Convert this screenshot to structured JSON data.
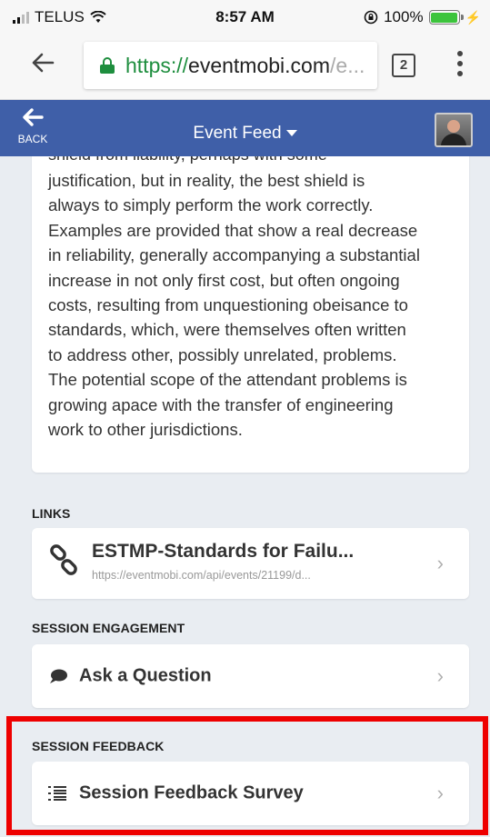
{
  "status_bar": {
    "carrier": "TELUS",
    "time": "8:57 AM",
    "battery": "100%"
  },
  "browser": {
    "url_scheme": "https://",
    "url_host": "eventmobi.com",
    "url_tail": "/e...",
    "tab_count": "2"
  },
  "header": {
    "back_label": "BACK",
    "title": "Event Feed"
  },
  "description": {
    "top_partial": "shield from liability, perhaps with some",
    "lines": [
      "justification, but in reality, the best shield is",
      "always to simply perform the work correctly.",
      "Examples are provided that show a real decrease",
      "in reliability, generally accompanying a substantial",
      "increase in not only first cost, but often ongoing",
      "costs, resulting from unquestioning obeisance to",
      "standards, which, were themselves often written",
      "to address other, possibly unrelated, problems.",
      "The potential scope of the attendant problems is",
      "growing apace with the transfer of engineering",
      "work to other jurisdictions."
    ]
  },
  "links": {
    "section_title": "LINKS",
    "item_title": "ESTMP-Standards for Failu...",
    "item_url": "https://eventmobi.com/api/events/21199/d..."
  },
  "engagement": {
    "section_title": "SESSION ENGAGEMENT",
    "item_label": "Ask a Question"
  },
  "feedback": {
    "section_title": "SESSION FEEDBACK",
    "item_label": "Session Feedback Survey"
  },
  "colors": {
    "header": "#3f5fa8",
    "highlight": "#ee0000",
    "secure": "#1e8e3e"
  },
  "icons": {
    "link": "link-icon",
    "question": "speech-bubble-icon",
    "survey": "list-icon",
    "chevron": "chevron-right-icon"
  }
}
